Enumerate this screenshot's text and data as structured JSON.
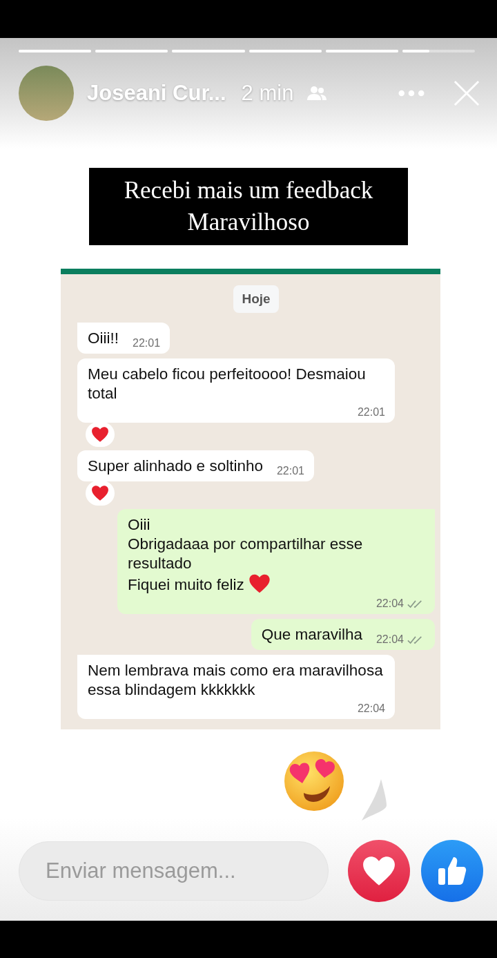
{
  "progress": [
    {
      "level": 1
    },
    {
      "level": 1
    },
    {
      "level": 1
    },
    {
      "level": 1
    },
    {
      "level": 1
    },
    {
      "level": 0.37
    }
  ],
  "header": {
    "name": "Joseani Cur...",
    "time": "2 min"
  },
  "caption": {
    "lines": [
      "Recebi mais um feedback",
      "Maravilhoso"
    ]
  },
  "chat": {
    "date": "Hoje",
    "messages": [
      {
        "kind": "incoming",
        "text": "Oiii!!",
        "time": "22:01",
        "tail": true,
        "reaction": false,
        "inline_heart": false,
        "read": false
      },
      {
        "kind": "incoming",
        "text": "Meu cabelo ficou perfeitoooo! Desmaiou total",
        "time": "22:01",
        "tail": false,
        "reaction": true,
        "inline_heart": false,
        "read": false
      },
      {
        "kind": "incoming",
        "text": "Super alinhado e soltinho",
        "time": "22:01",
        "tail": false,
        "reaction": true,
        "inline_heart": false,
        "read": false
      },
      {
        "kind": "outgoing",
        "text": "Oiii\nObrigadaaa por compartilhar esse resultado\nFiquei muito feliz",
        "time": "22:04",
        "tail": true,
        "reaction": false,
        "inline_heart": true,
        "read": true
      },
      {
        "kind": "outgoing",
        "text": "Que maravilha",
        "time": "22:04",
        "tail": false,
        "reaction": false,
        "inline_heart": false,
        "read": true
      },
      {
        "kind": "incoming",
        "text": "Nem lembrava mais como era maravilhosa essa blindagem kkkkkkk",
        "time": "22:04",
        "tail": true,
        "reaction": false,
        "inline_heart": false,
        "read": false
      }
    ]
  },
  "reply": {
    "placeholder": "Enviar mensagem..."
  }
}
